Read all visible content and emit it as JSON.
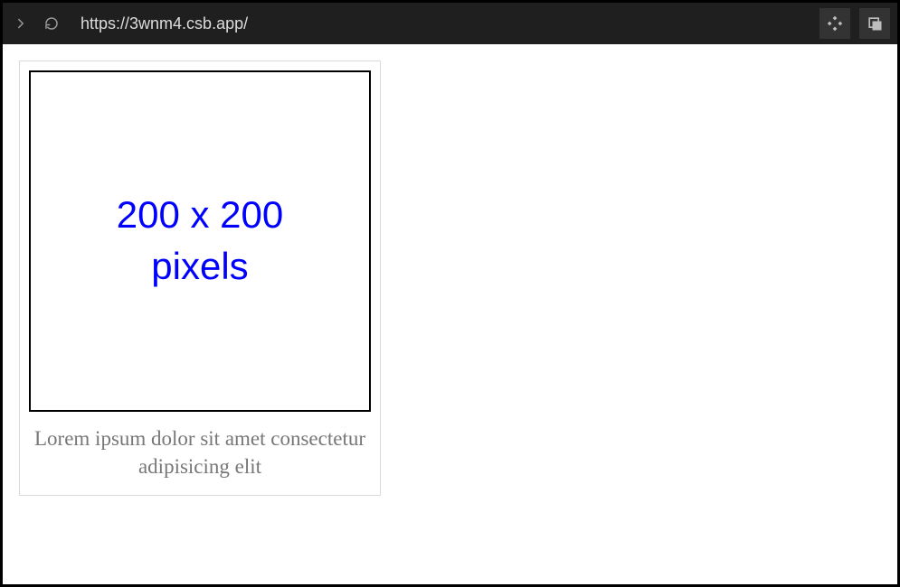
{
  "toolbar": {
    "url": "https://3wnm4.csb.app/"
  },
  "card": {
    "placeholder_line1": "200 x 200",
    "placeholder_line2": "pixels",
    "caption": "Lorem ipsum dolor sit amet consectetur adipisicing elit"
  }
}
